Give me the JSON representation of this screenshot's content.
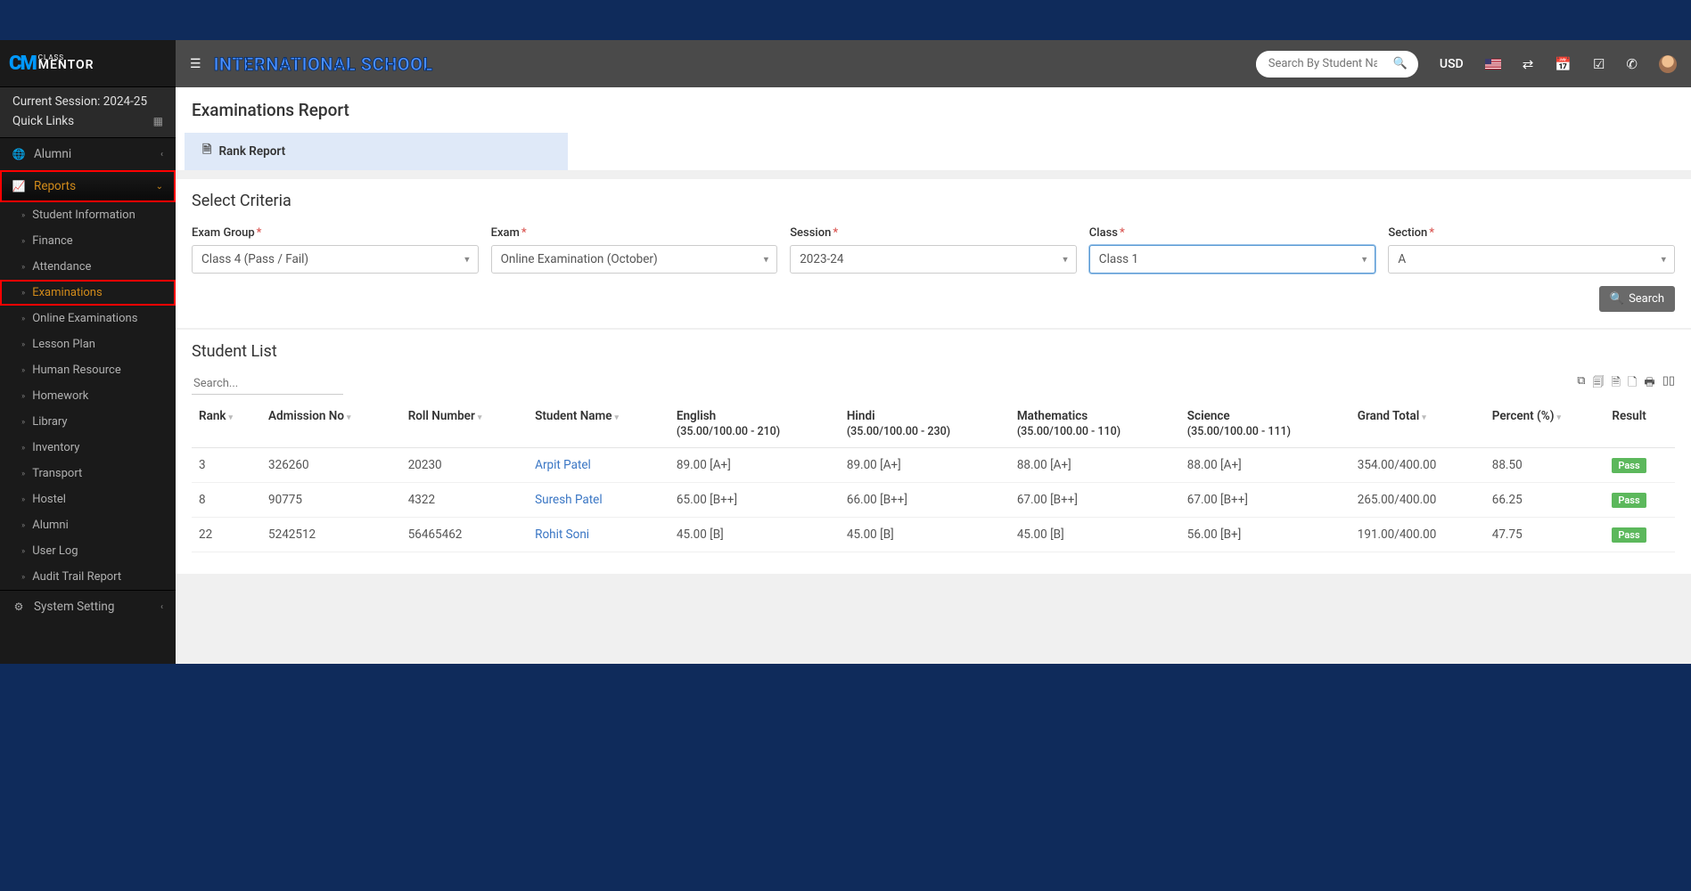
{
  "logo": {
    "class_text": "CLASS",
    "mentor_text": "MENTOR"
  },
  "session_label": "Current Session: 2024-25",
  "quick_links_label": "Quick Links",
  "sidebar": {
    "alumni": "Alumni",
    "reports": "Reports",
    "sub": {
      "student_info": "Student Information",
      "finance": "Finance",
      "attendance": "Attendance",
      "examinations": "Examinations",
      "online_exam": "Online Examinations",
      "lesson_plan": "Lesson Plan",
      "hr": "Human Resource",
      "homework": "Homework",
      "library": "Library",
      "inventory": "Inventory",
      "transport": "Transport",
      "hostel": "Hostel",
      "alumni2": "Alumni",
      "user_log": "User Log",
      "audit": "Audit Trail Report"
    },
    "system_setting": "System Setting"
  },
  "topbar": {
    "school": "INTERNATIONAL SCHOOL",
    "search_placeholder": "Search By Student Name",
    "currency": "USD"
  },
  "page": {
    "title": "Examinations Report",
    "rank_report": "Rank Report",
    "criteria_title": "Select Criteria",
    "labels": {
      "exam_group": "Exam Group",
      "exam": "Exam",
      "session": "Session",
      "class": "Class",
      "section": "Section"
    },
    "values": {
      "exam_group": "Class 4 (Pass / Fail)",
      "exam": "Online Examination (October)",
      "session": "2023-24",
      "class": "Class 1",
      "section": "A"
    },
    "search_btn": "Search",
    "list_title": "Student List",
    "list_search_placeholder": "Search...",
    "columns": {
      "rank": "Rank",
      "admission": "Admission No",
      "roll": "Roll Number",
      "student": "Student Name",
      "english": "English",
      "english_sub": "(35.00/100.00 - 210)",
      "hindi": "Hindi",
      "hindi_sub": "(35.00/100.00 - 230)",
      "math": "Mathematics",
      "math_sub": "(35.00/100.00 - 110)",
      "science": "Science",
      "science_sub": "(35.00/100.00 - 111)",
      "grand": "Grand Total",
      "percent": "Percent (%)",
      "result": "Result"
    },
    "rows": [
      {
        "rank": "3",
        "admission": "326260",
        "roll": "20230",
        "name": "Arpit Patel",
        "english": "89.00 [A+]",
        "hindi": "89.00 [A+]",
        "math": "88.00 [A+]",
        "science": "88.00 [A+]",
        "grand": "354.00/400.00",
        "percent": "88.50",
        "result": "Pass"
      },
      {
        "rank": "8",
        "admission": "90775",
        "roll": "4322",
        "name": "Suresh Patel",
        "english": "65.00 [B++]",
        "hindi": "66.00 [B++]",
        "math": "67.00 [B++]",
        "science": "67.00 [B++]",
        "grand": "265.00/400.00",
        "percent": "66.25",
        "result": "Pass"
      },
      {
        "rank": "22",
        "admission": "5242512",
        "roll": "56465462",
        "name": "Rohit Soni",
        "english": "45.00 [B]",
        "hindi": "45.00 [B]",
        "math": "45.00 [B]",
        "science": "56.00 [B+]",
        "grand": "191.00/400.00",
        "percent": "47.75",
        "result": "Pass"
      }
    ]
  }
}
